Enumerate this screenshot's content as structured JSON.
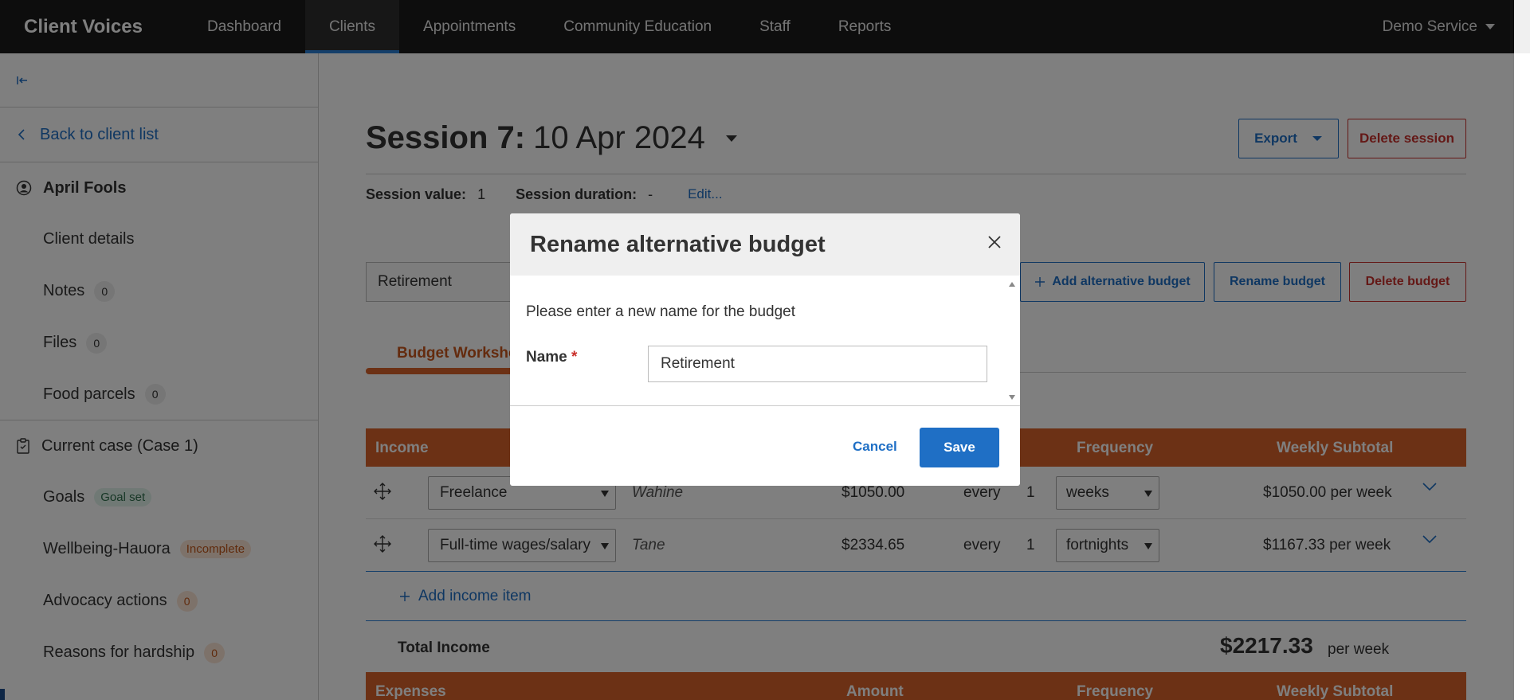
{
  "nav": {
    "brand": "Client Voices",
    "items": [
      "Dashboard",
      "Clients",
      "Appointments",
      "Community Education",
      "Staff",
      "Reports"
    ],
    "active": "Clients",
    "service": "Demo Service"
  },
  "sidebar": {
    "back": "Back to client list",
    "client_name": "April Fools",
    "client_items": [
      {
        "label": "Client details"
      },
      {
        "label": "Notes",
        "count": "0"
      },
      {
        "label": "Files",
        "count": "0"
      },
      {
        "label": "Food parcels",
        "count": "0"
      }
    ],
    "case_title": "Current case (Case 1)",
    "case_items": [
      {
        "label": "Goals",
        "badge": "Goal set"
      },
      {
        "label": "Wellbeing-Hauora",
        "badge": "Incomplete"
      },
      {
        "label": "Advocacy actions",
        "count": "0"
      },
      {
        "label": "Reasons for hardship",
        "count": "0"
      }
    ]
  },
  "session": {
    "title_bold": "Session 7:",
    "title_date": "10 Apr 2024",
    "value_label": "Session value:",
    "value": "1",
    "duration_label": "Session duration:",
    "duration": "-",
    "edit": "Edit..."
  },
  "actions": {
    "export": "Export",
    "delete_session": "Delete session",
    "add_alt_budget": "Add alternative budget",
    "rename_budget": "Rename budget",
    "delete_budget": "Delete budget"
  },
  "budget": {
    "selected": "Retirement",
    "tab": "Budget Worksheet",
    "income_headers": {
      "income": "Income",
      "frequency": "Frequency",
      "weekly_subtotal": "Weekly Subtotal"
    },
    "income_rows": [
      {
        "type": "Freelance",
        "person": "Wahine",
        "amount": "$1050.00",
        "every": "every",
        "n": "1",
        "freq": "weeks",
        "subtotal": "$1050.00 per week"
      },
      {
        "type": "Full-time wages/salary",
        "person": "Tane",
        "amount": "$2334.65",
        "every": "every",
        "n": "1",
        "freq": "fortnights",
        "subtotal": "$1167.33 per week"
      }
    ],
    "add_income": "Add income item",
    "total_label": "Total Income",
    "total_value": "$2217.33",
    "total_per": "per week",
    "expense_headers": {
      "expenses": "Expenses",
      "amount": "Amount",
      "frequency": "Frequency",
      "weekly_subtotal": "Weekly Subtotal"
    }
  },
  "modal": {
    "title": "Rename alternative budget",
    "intro": "Please enter a new name for the budget",
    "name_label": "Name",
    "required_mark": "*",
    "name_value": "Retirement",
    "cancel": "Cancel",
    "save": "Save"
  },
  "colors": {
    "accent": "#1f6fc5",
    "table_header": "#d9622a",
    "danger": "#c9302c",
    "nav_bg": "#1a1a1a"
  }
}
